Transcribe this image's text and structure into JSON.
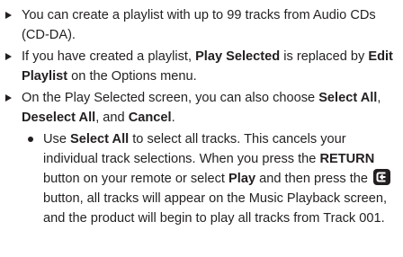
{
  "items": [
    {
      "text": "You can create a playlist with up to 99 tracks from Audio CDs (CD-DA)."
    },
    {
      "t1": "If you have created a playlist, ",
      "b1": "Play Selected",
      "t2": " is replaced by ",
      "b2": "Edit Playlist",
      "t3": " on the Options menu."
    },
    {
      "t1": "On the Play Selected screen, you can also choose ",
      "b1": "Select All",
      "t2": ", ",
      "b2": "Deselect All",
      "t3": ", and ",
      "b3": "Cancel",
      "t4": ".",
      "sub": {
        "t1": "Use ",
        "b1": "Select All",
        "t2": " to select all tracks. This cancels your individual track selections. When you press the ",
        "b2": "RETURN",
        "t3": " button on your remote or select ",
        "b3": "Play",
        "t4": " and then press the ",
        "icon": "return-button-icon",
        "t5": " button, all tracks will appear on the Music Playback screen, and the product will begin to play all tracks from Track 001."
      }
    }
  ]
}
